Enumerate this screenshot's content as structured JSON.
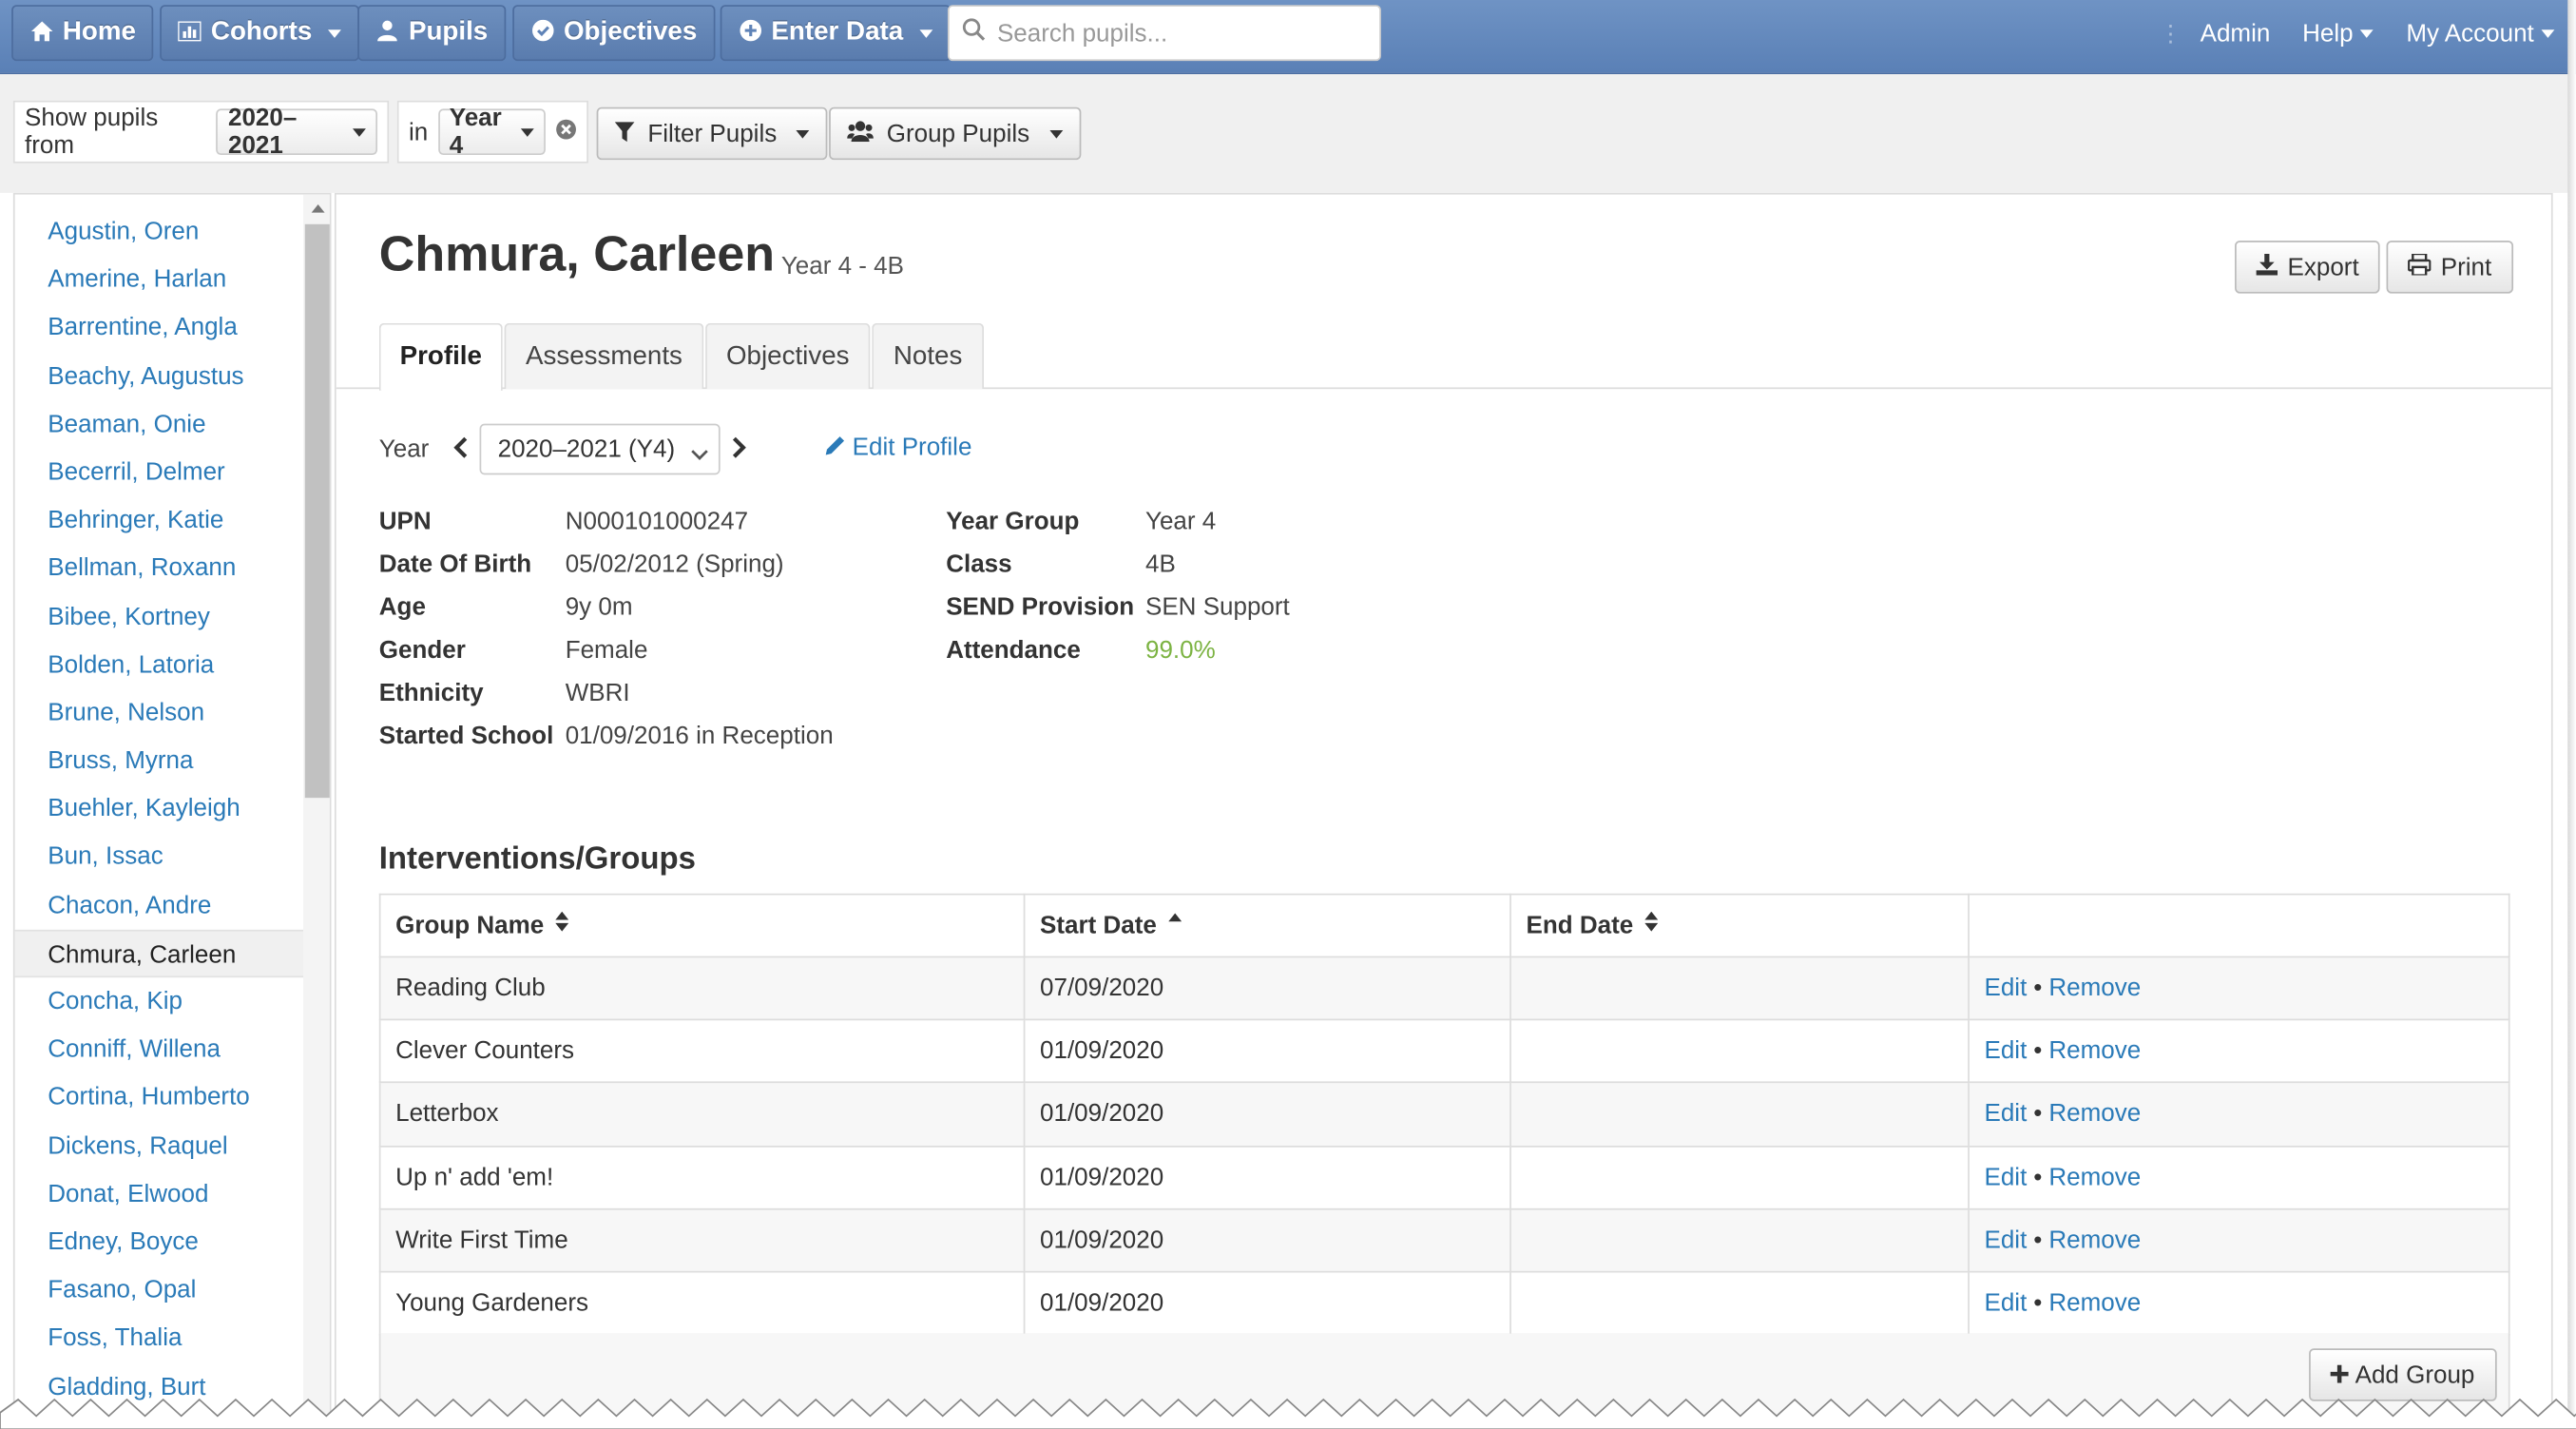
{
  "navbar": {
    "home": "Home",
    "cohorts": "Cohorts",
    "pupils": "Pupils",
    "objectives": "Objectives",
    "enter_data": "Enter Data",
    "search_placeholder": "Search pupils...",
    "admin": "Admin",
    "help": "Help",
    "my_account": "My Account"
  },
  "filters": {
    "show_pupils_from": "Show pupils from",
    "year_range": "2020–2021",
    "in_label": "in",
    "year_group": "Year 4",
    "filter_pupils": "Filter Pupils",
    "group_pupils": "Group Pupils"
  },
  "pupil_list": [
    "Agustin, Oren",
    "Amerine, Harlan",
    "Barrentine, Angla",
    "Beachy, Augustus",
    "Beaman, Onie",
    "Becerril, Delmer",
    "Behringer, Katie",
    "Bellman, Roxann",
    "Bibee, Kortney",
    "Bolden, Latoria",
    "Brune, Nelson",
    "Bruss, Myrna",
    "Buehler, Kayleigh",
    "Bun, Issac",
    "Chacon, Andre",
    "Chmura, Carleen",
    "Concha, Kip",
    "Conniff, Willena",
    "Cortina, Humberto",
    "Dickens, Raquel",
    "Donat, Elwood",
    "Edney, Boyce",
    "Fasano, Opal",
    "Foss, Thalia",
    "Gladding, Burt"
  ],
  "active_pupil_index": 15,
  "pupil": {
    "name": "Chmura, Carleen",
    "subtitle": "Year 4 - 4B",
    "export": "Export",
    "print": "Print"
  },
  "tabs": [
    "Profile",
    "Assessments",
    "Objectives",
    "Notes"
  ],
  "active_tab": 0,
  "year_selector": {
    "label": "Year",
    "value": "2020–2021 (Y4)",
    "edit_profile": "Edit Profile"
  },
  "profile_left": [
    {
      "key": "UPN",
      "value": "N000101000247"
    },
    {
      "key": "Date Of Birth",
      "value": "05/02/2012 (Spring)"
    },
    {
      "key": "Age",
      "value": "9y 0m"
    },
    {
      "key": "Gender",
      "value": "Female"
    },
    {
      "key": "Ethnicity",
      "value": "WBRI"
    },
    {
      "key": "Started School",
      "value": "01/09/2016 in Reception"
    }
  ],
  "profile_right": [
    {
      "key": "Year Group",
      "value": "Year 4"
    },
    {
      "key": "Class",
      "value": "4B"
    },
    {
      "key": "SEND Provision",
      "value": "SEN Support"
    },
    {
      "key": "Attendance",
      "value": "99.0%"
    }
  ],
  "attendance_color": "#7cb342",
  "interventions": {
    "title": "Interventions/Groups",
    "columns": [
      "Group Name",
      "Start Date",
      "End Date",
      ""
    ],
    "rows": [
      {
        "name": "Reading Club",
        "start": "07/09/2020",
        "end": ""
      },
      {
        "name": "Clever Counters",
        "start": "01/09/2020",
        "end": ""
      },
      {
        "name": "Letterbox",
        "start": "01/09/2020",
        "end": ""
      },
      {
        "name": "Up n' add 'em!",
        "start": "01/09/2020",
        "end": ""
      },
      {
        "name": "Write First Time",
        "start": "01/09/2020",
        "end": ""
      },
      {
        "name": "Young Gardeners",
        "start": "01/09/2020",
        "end": ""
      }
    ],
    "edit_label": "Edit",
    "separator": "•",
    "remove_label": "Remove",
    "add_group": "Add Group"
  }
}
